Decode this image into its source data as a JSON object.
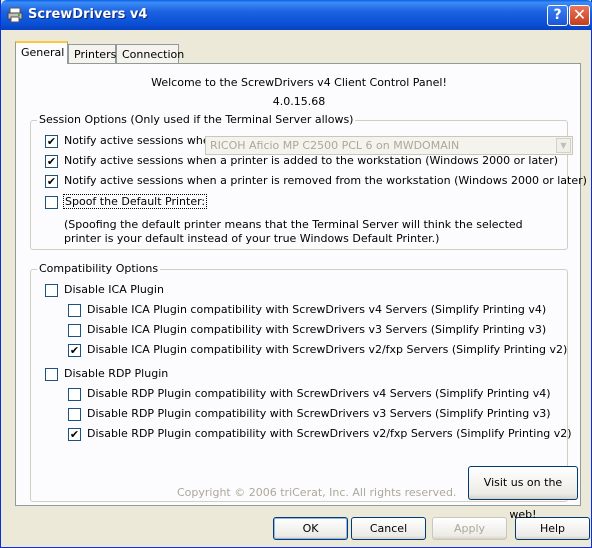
{
  "window": {
    "title": "ScrewDrivers v4"
  },
  "tabs": [
    "General",
    "Printers",
    "Connection"
  ],
  "general": {
    "welcome": "Welcome to the ScrewDrivers v4 Client Control Panel!",
    "version": "4.0.15.68",
    "session_group": {
      "legend": "Session Options (Only used if the Terminal Server allows)",
      "items": [
        {
          "label": "Notify active sessions when the local default printer changes",
          "checked": true
        },
        {
          "label": "Notify active sessions when a printer is added to the workstation (Windows 2000 or later)",
          "checked": true
        },
        {
          "label": "Notify active sessions when a printer is removed from the workstation (Windows 2000 or later)",
          "checked": true
        }
      ],
      "spoof_label": "Spoof the Default Printer:",
      "spoof_checked": false,
      "spoof_printer": "RICOH Aficio MP C2500 PCL 6 on MWDOMAIN",
      "note": "(Spoofing the default printer means that the Terminal Server will think the selected printer is your default instead of your true Windows Default Printer.)"
    },
    "compat_group": {
      "legend": "Compatibility Options",
      "ica": {
        "label": "Disable ICA Plugin",
        "checked": false,
        "items": [
          {
            "label": "Disable ICA Plugin compatibility with ScrewDrivers v4 Servers (Simplify Printing v4)",
            "checked": false
          },
          {
            "label": "Disable ICA Plugin compatibility with ScrewDrivers v3 Servers (Simplify Printing v3)",
            "checked": false
          },
          {
            "label": "Disable ICA Plugin compatibility with ScrewDrivers v2/fxp Servers (Simplify Printing v2)",
            "checked": true
          }
        ]
      },
      "rdp": {
        "label": "Disable RDP Plugin",
        "checked": false,
        "items": [
          {
            "label": "Disable RDP Plugin compatibility with ScrewDrivers v4 Servers (Simplify Printing v4)",
            "checked": false
          },
          {
            "label": "Disable RDP Plugin compatibility with ScrewDrivers v3 Servers (Simplify Printing v3)",
            "checked": false
          },
          {
            "label": "Disable RDP Plugin compatibility with ScrewDrivers v2/fxp Servers (Simplify Printing v2)",
            "checked": true
          }
        ]
      }
    },
    "copyright": "Copyright © 2006 triCerat, Inc.  All rights reserved.",
    "visit_button": "Visit us on the web!"
  },
  "buttons": {
    "ok": "OK",
    "cancel": "Cancel",
    "apply": "Apply",
    "help": "Help"
  },
  "icons": {
    "app": "printer-icon",
    "help": "help-icon",
    "close": "close-icon",
    "dropdown": "chevron-down-icon"
  },
  "colors": {
    "titlebar": "#0a50d6",
    "close": "#c63c1e",
    "tab_highlight": "#ffc83c"
  }
}
